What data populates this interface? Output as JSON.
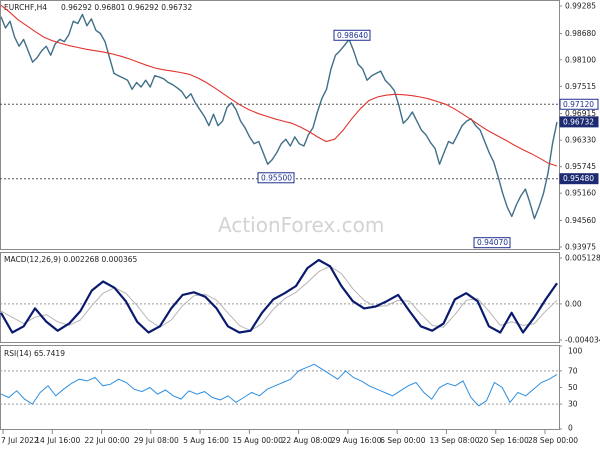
{
  "header": {
    "symbol_tf": "EURCHF,H4",
    "ohlc": "0.96292 0.96801 0.96292 0.96732"
  },
  "watermark": "ActionForex.com",
  "colors": {
    "price": "#3f6f88",
    "ma": "#e2342e",
    "macd": "#0a1a6e",
    "signal": "#b5b5b5",
    "rsi": "#2f8fe0",
    "label_box": "#1f2f8f"
  },
  "chart_data": [
    {
      "type": "line",
      "title": "EURCHF,H4",
      "ylim": [
        0.93975,
        0.99285
      ],
      "y_ticks": [
        "0.99285",
        "0.98680",
        "0.98100",
        "0.97515",
        "0.96915",
        "0.96330",
        "0.95745",
        "0.95160",
        "0.94560",
        "0.93975"
      ],
      "x_ticks": [
        "7 Jul 2022",
        "14 Jul 16:00",
        "22 Jul 00:00",
        "29 Jul 08:00",
        "5 Aug 16:00",
        "15 Aug 00:00",
        "22 Aug 08:00",
        "29 Aug 16:00",
        "6 Sep 00:00",
        "13 Sep 08:00",
        "20 Sep 16:00",
        "28 Sep 00:00"
      ],
      "series": [
        {
          "values": [
            0.9905,
            0.988,
            0.9895,
            0.986,
            0.984,
            0.9855,
            0.983,
            0.9805,
            0.9815,
            0.983,
            0.984,
            0.982,
            0.9845,
            0.9855,
            0.985,
            0.9865,
            0.9895,
            0.989,
            0.991,
            0.9885,
            0.99,
            0.9875,
            0.9868,
            0.985,
            0.9815,
            0.978,
            0.9775,
            0.977,
            0.9765,
            0.9745,
            0.976,
            0.975,
            0.9765,
            0.975,
            0.9775,
            0.9772,
            0.9768,
            0.976,
            0.9755,
            0.9748,
            0.974,
            0.9725,
            0.9735,
            0.9715,
            0.97,
            0.9685,
            0.9665,
            0.969,
            0.9665,
            0.9675,
            0.9705,
            0.9715,
            0.97,
            0.9675,
            0.966,
            0.964,
            0.9625,
            0.963,
            0.9605,
            0.958,
            0.959,
            0.9605,
            0.9625,
            0.9635,
            0.962,
            0.964,
            0.9625,
            0.962,
            0.9645,
            0.966,
            0.9695,
            0.9725,
            0.9745,
            0.979,
            0.982,
            0.983,
            0.9842,
            0.9855,
            0.983,
            0.98,
            0.979,
            0.9765,
            0.9775,
            0.978,
            0.9785,
            0.9765,
            0.9755,
            0.9742,
            0.971,
            0.967,
            0.968,
            0.9695,
            0.9675,
            0.9655,
            0.9645,
            0.9628,
            0.9615,
            0.958,
            0.9605,
            0.963,
            0.9625,
            0.9645,
            0.9665,
            0.9675,
            0.968,
            0.9665,
            0.9655,
            0.963,
            0.9605,
            0.9585,
            0.9552,
            0.9515,
            0.9485,
            0.9465,
            0.949,
            0.951,
            0.9525,
            0.9495,
            0.946,
            0.9485,
            0.9515,
            0.956,
            0.9625,
            0.9673
          ],
          "color": "#3f6f88"
        },
        {
          "values": [
            0.993,
            0.9915,
            0.9898,
            0.9885,
            0.9872,
            0.986,
            0.9852,
            0.9846,
            0.9841,
            0.9837,
            0.9833,
            0.983,
            0.9827,
            0.9823,
            0.9818,
            0.9812,
            0.9805,
            0.9798,
            0.9792,
            0.9788,
            0.9785,
            0.9782,
            0.9778,
            0.977,
            0.976,
            0.9748,
            0.9735,
            0.9722,
            0.971,
            0.97,
            0.9692,
            0.9686,
            0.968,
            0.9675,
            0.967,
            0.9662,
            0.9652,
            0.964,
            0.963,
            0.9635,
            0.9655,
            0.968,
            0.9702,
            0.972,
            0.9728,
            0.9732,
            0.9734,
            0.9733,
            0.9731,
            0.9728,
            0.9724,
            0.9718,
            0.9712,
            0.9702,
            0.969,
            0.9678,
            0.9665,
            0.9653,
            0.9643,
            0.9633,
            0.9622,
            0.9612,
            0.9603,
            0.9593,
            0.9582,
            0.9576
          ],
          "color": "#e2342e"
        }
      ],
      "price_labels": {
        "current": "0.96732",
        "resistance": "0.97120",
        "support": "0.95480",
        "high": "0.98640",
        "low_aug": "0.95500",
        "low_sep": "0.94070"
      }
    },
    {
      "type": "line",
      "title": "MACD(12,26,9) 0.002268 0.000365",
      "ylim": [
        -0.004034,
        0.005128
      ],
      "y_ticks": [
        "0.005128",
        "0.00",
        "-0.004034"
      ],
      "series": [
        {
          "name": "MACD",
          "values": [
            -0.001,
            -0.0032,
            -0.0025,
            -0.0005,
            -0.002,
            -0.003,
            -0.0022,
            -0.0008,
            0.0015,
            0.0025,
            0.0018,
            0.0003,
            -0.002,
            -0.0032,
            -0.0025,
            -0.0005,
            0.001,
            0.0013,
            0.0008,
            -0.0005,
            -0.0025,
            -0.0032,
            -0.003,
            -0.001,
            0.0005,
            0.0012,
            0.002,
            0.004,
            0.0049,
            0.0042,
            0.002,
            0.0003,
            -0.0005,
            -0.0003,
            0.0003,
            0.001,
            -0.0008,
            -0.0025,
            -0.003,
            -0.0022,
            0.0005,
            0.0012,
            0.0003,
            -0.0025,
            -0.0032,
            -0.001,
            -0.0032,
            -0.0015,
            0.0005,
            0.0023
          ],
          "color": "#0a1a6e"
        },
        {
          "name": "Signal",
          "values": [
            -0.0008,
            -0.0015,
            -0.0022,
            -0.0015,
            -0.0012,
            -0.002,
            -0.0024,
            -0.0018,
            -0.0002,
            0.0012,
            0.0018,
            0.0012,
            -0.0002,
            -0.0018,
            -0.0026,
            -0.0018,
            -0.0002,
            0.0009,
            0.0011,
            0.0004,
            -0.001,
            -0.0024,
            -0.003,
            -0.0022,
            -0.0006,
            0.0006,
            0.0013,
            0.0024,
            0.0036,
            0.0042,
            0.0034,
            0.0017,
            0.0004,
            -0.0003,
            -0.0002,
            0.0004,
            0.0003,
            -0.0011,
            -0.0024,
            -0.0026,
            -0.0012,
            0.0004,
            0.0006,
            -0.0008,
            -0.0024,
            -0.002,
            -0.0024,
            -0.0022,
            -0.0008,
            0.0004
          ],
          "color": "#b5b5b5"
        }
      ]
    },
    {
      "type": "line",
      "title": "RSI(14) 65.7419",
      "ylim": [
        0,
        100
      ],
      "y_ticks": [
        "100",
        "70",
        "50",
        "30",
        "0"
      ],
      "series": [
        {
          "name": "RSI",
          "values": [
            42,
            38,
            46,
            36,
            30,
            44,
            52,
            40,
            48,
            55,
            60,
            58,
            62,
            52,
            54,
            60,
            56,
            48,
            45,
            50,
            42,
            47,
            40,
            36,
            46,
            42,
            45,
            38,
            35,
            40,
            32,
            38,
            44,
            40,
            48,
            52,
            56,
            60,
            70,
            74,
            78,
            72,
            66,
            60,
            70,
            62,
            58,
            52,
            48,
            44,
            40,
            46,
            52,
            56,
            44,
            36,
            50,
            55,
            52,
            58,
            38,
            28,
            34,
            56,
            50,
            32,
            44,
            40,
            48,
            56,
            60,
            65.74
          ],
          "color": "#2f8fe0"
        }
      ]
    }
  ]
}
